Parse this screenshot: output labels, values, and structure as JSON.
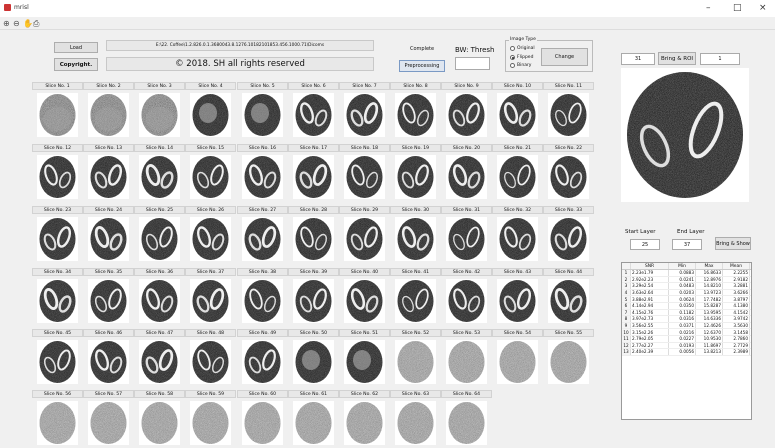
{
  "window": {
    "title": "mrisl",
    "minimize": "–",
    "maximize": "□",
    "close": "×"
  },
  "toolbar": [
    "zoom-in-icon",
    "zoom-out-icon",
    "pan-icon",
    "print-icon"
  ],
  "controls": {
    "load": "Load",
    "copyright": "Copyright.",
    "filepath": "E:\\22. Coffee\\1.2.826.0.1.3680043.8.1276.10182101853.456.1000.71\\Dicoms",
    "notice": "© 2018. SH all rights reserved",
    "complete": "Complete",
    "preprocessing": "Preprocessing",
    "bw_label": "BW: Thresh",
    "bw_value": "",
    "image_type_label": "Image Type",
    "image_types": [
      {
        "label": "Original",
        "selected": false
      },
      {
        "label": "Flipped",
        "selected": true
      },
      {
        "label": "Binary",
        "selected": false
      }
    ],
    "change": "Change",
    "slice_value": "31",
    "bring_roi": "Bring & ROI",
    "roi_value": "1",
    "start_layer_label": "Start Layer",
    "end_layer_label": "End Layer",
    "start_layer": "25",
    "end_layer": "37",
    "bring_show": "Bring & Show"
  },
  "slices": [
    {
      "label": "Slice No. 1",
      "k": "full"
    },
    {
      "label": "Slice No. 2",
      "k": "full"
    },
    {
      "label": "Slice No. 3",
      "k": "full"
    },
    {
      "label": "Slice No. 4",
      "k": "blob"
    },
    {
      "label": "Slice No. 5",
      "k": "blob"
    },
    {
      "label": "Slice No. 6",
      "k": "ring"
    },
    {
      "label": "Slice No. 7",
      "k": "ring"
    },
    {
      "label": "Slice No. 8",
      "k": "ring"
    },
    {
      "label": "Slice No. 9",
      "k": "ring"
    },
    {
      "label": "Slice No. 10",
      "k": "ring"
    },
    {
      "label": "Slice No. 11",
      "k": "ring"
    },
    {
      "label": "Slice No. 12",
      "k": "ring"
    },
    {
      "label": "Slice No. 13",
      "k": "ring"
    },
    {
      "label": "Slice No. 14",
      "k": "ring"
    },
    {
      "label": "Slice No. 15",
      "k": "ring"
    },
    {
      "label": "Slice No. 16",
      "k": "ring"
    },
    {
      "label": "Slice No. 17",
      "k": "ring"
    },
    {
      "label": "Slice No. 18",
      "k": "ring"
    },
    {
      "label": "Slice No. 19",
      "k": "ring"
    },
    {
      "label": "Slice No. 20",
      "k": "ring"
    },
    {
      "label": "Slice No. 21",
      "k": "ring"
    },
    {
      "label": "Slice No. 22",
      "k": "ring"
    },
    {
      "label": "Slice No. 23",
      "k": "ring"
    },
    {
      "label": "Slice No. 24",
      "k": "ring"
    },
    {
      "label": "Slice No. 25",
      "k": "ring"
    },
    {
      "label": "Slice No. 26",
      "k": "ring"
    },
    {
      "label": "Slice No. 27",
      "k": "ring"
    },
    {
      "label": "Slice No. 28",
      "k": "ring"
    },
    {
      "label": "Slice No. 29",
      "k": "ring"
    },
    {
      "label": "Slice No. 30",
      "k": "ring"
    },
    {
      "label": "Slice No. 31",
      "k": "ring"
    },
    {
      "label": "Slice No. 32",
      "k": "ring"
    },
    {
      "label": "Slice No. 33",
      "k": "ring"
    },
    {
      "label": "Slice No. 34",
      "k": "ring"
    },
    {
      "label": "Slice No. 35",
      "k": "ring"
    },
    {
      "label": "Slice No. 36",
      "k": "ring"
    },
    {
      "label": "Slice No. 37",
      "k": "ring"
    },
    {
      "label": "Slice No. 38",
      "k": "ring"
    },
    {
      "label": "Slice No. 39",
      "k": "ring"
    },
    {
      "label": "Slice No. 40",
      "k": "ring"
    },
    {
      "label": "Slice No. 41",
      "k": "ring"
    },
    {
      "label": "Slice No. 42",
      "k": "ring"
    },
    {
      "label": "Slice No. 43",
      "k": "ring"
    },
    {
      "label": "Slice No. 44",
      "k": "ring"
    },
    {
      "label": "Slice No. 45",
      "k": "ring"
    },
    {
      "label": "Slice No. 46",
      "k": "ring"
    },
    {
      "label": "Slice No. 47",
      "k": "ring"
    },
    {
      "label": "Slice No. 48",
      "k": "ring"
    },
    {
      "label": "Slice No. 49",
      "k": "ring"
    },
    {
      "label": "Slice No. 50",
      "k": "blob"
    },
    {
      "label": "Slice No. 51",
      "k": "blob"
    },
    {
      "label": "Slice No. 52",
      "k": "noise"
    },
    {
      "label": "Slice No. 53",
      "k": "noise"
    },
    {
      "label": "Slice No. 54",
      "k": "noise"
    },
    {
      "label": "Slice No. 55",
      "k": "noise"
    },
    {
      "label": "Slice No. 56",
      "k": "noise"
    },
    {
      "label": "Slice No. 57",
      "k": "noise"
    },
    {
      "label": "Slice No. 58",
      "k": "noise"
    },
    {
      "label": "Slice No. 59",
      "k": "noise"
    },
    {
      "label": "Slice No. 60",
      "k": "noise"
    },
    {
      "label": "Slice No. 61",
      "k": "noise"
    },
    {
      "label": "Slice No. 62",
      "k": "noise"
    },
    {
      "label": "Slice No. 63",
      "k": "noise"
    },
    {
      "label": "Slice No. 64",
      "k": "noise"
    }
  ],
  "table": {
    "headers": [
      "",
      "SNR",
      "Min",
      "Max",
      "Mean"
    ],
    "rows": [
      [
        "1",
        "2.23e1.79",
        "0.0883",
        "16.8633",
        "2.2255"
      ],
      [
        "2",
        "2.92e2.23",
        "0.0241",
        "12.8976",
        "2.9182"
      ],
      [
        "3",
        "3.29e2.54",
        "0.0483",
        "14.8210",
        "3.2881"
      ],
      [
        "4",
        "3.63e2.64",
        "0.0203",
        "13.9723",
        "3.6266"
      ],
      [
        "5",
        "3.88e2.91",
        "0.0624",
        "17.7482",
        "3.8797"
      ],
      [
        "6",
        "4.14e2.94",
        "0.0350",
        "15.8287",
        "4.1380"
      ],
      [
        "7",
        "4.15e2.76",
        "0.1182",
        "13.9595",
        "4.1542"
      ],
      [
        "8",
        "3.97e2.73",
        "0.0316",
        "14.6336",
        "3.9742"
      ],
      [
        "9",
        "3.56e2.55",
        "0.0371",
        "12.4626",
        "3.5630"
      ],
      [
        "10",
        "3.15e2.26",
        "0.0216",
        "12.6370",
        "3.1458"
      ],
      [
        "11",
        "2.79e2.05",
        "0.0227",
        "10.9530",
        "2.7860"
      ],
      [
        "12",
        "2.77e2.27",
        "0.0193",
        "11.8697",
        "2.7729"
      ],
      [
        "13",
        "2.40e2.39",
        "0.0056",
        "13.8213",
        "2.3989"
      ]
    ]
  }
}
